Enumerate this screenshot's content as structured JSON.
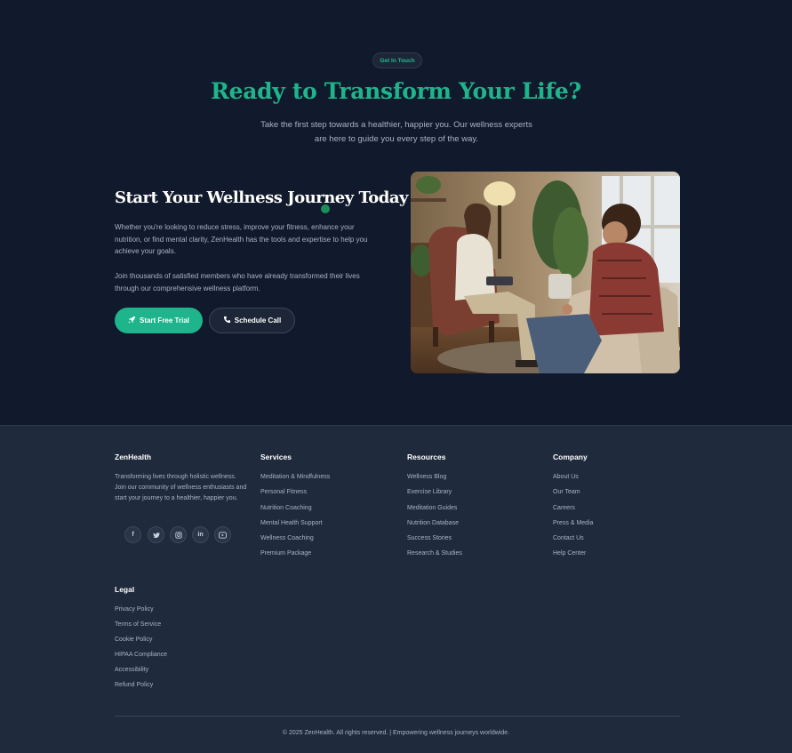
{
  "hero": {
    "badge": "Get In Touch",
    "title": "Ready to Transform Your Life?",
    "subtitle": "Take the first step towards a healthier, happier you. Our wellness experts are here to guide you every step of the way."
  },
  "journey": {
    "title": "Start Your Wellness Journey Today",
    "para1": "Whether you're looking to reduce stress, improve your fitness, enhance your nutrition, or find mental clarity, ZenHealth has the tools and expertise to help you achieve your goals.",
    "para2": "Join thousands of satisfied members who have already transformed their lives through our comprehensive wellness platform.",
    "primary_button": "Start Free Trial",
    "primary_icon": "rocket-icon",
    "secondary_button": "Schedule Call",
    "secondary_icon": "phone-icon"
  },
  "colors": {
    "accent": "#1eb58c",
    "background": "#111a2c",
    "footer_background": "#1f2a3d"
  },
  "footer": {
    "brand": {
      "title": "ZenHealth",
      "description": "Transforming lives through holistic wellness. Join our community of wellness enthusiasts and start your journey to a healthier, happier you.",
      "socials": [
        "facebook-icon",
        "twitter-icon",
        "instagram-icon",
        "linkedin-icon",
        "youtube-icon"
      ]
    },
    "services": {
      "title": "Services",
      "links": [
        "Meditation & Mindfulness",
        "Personal Fitness",
        "Nutrition Coaching",
        "Mental Health Support",
        "Wellness Coaching",
        "Premium Package"
      ]
    },
    "resources": {
      "title": "Resources",
      "links": [
        "Wellness Blog",
        "Exercise Library",
        "Meditation Guides",
        "Nutrition Database",
        "Success Stories",
        "Research & Studies"
      ]
    },
    "company": {
      "title": "Company",
      "links": [
        "About Us",
        "Our Team",
        "Careers",
        "Press & Media",
        "Contact Us",
        "Help Center"
      ]
    },
    "legal": {
      "title": "Legal",
      "links": [
        "Privacy Policy",
        "Terms of Service",
        "Cookie Policy",
        "HIPAA Compliance",
        "Accessibility",
        "Refund Policy"
      ]
    },
    "copyright": "© 2025 ZenHealth. All rights reserved. | Empowering wellness journeys worldwide."
  }
}
